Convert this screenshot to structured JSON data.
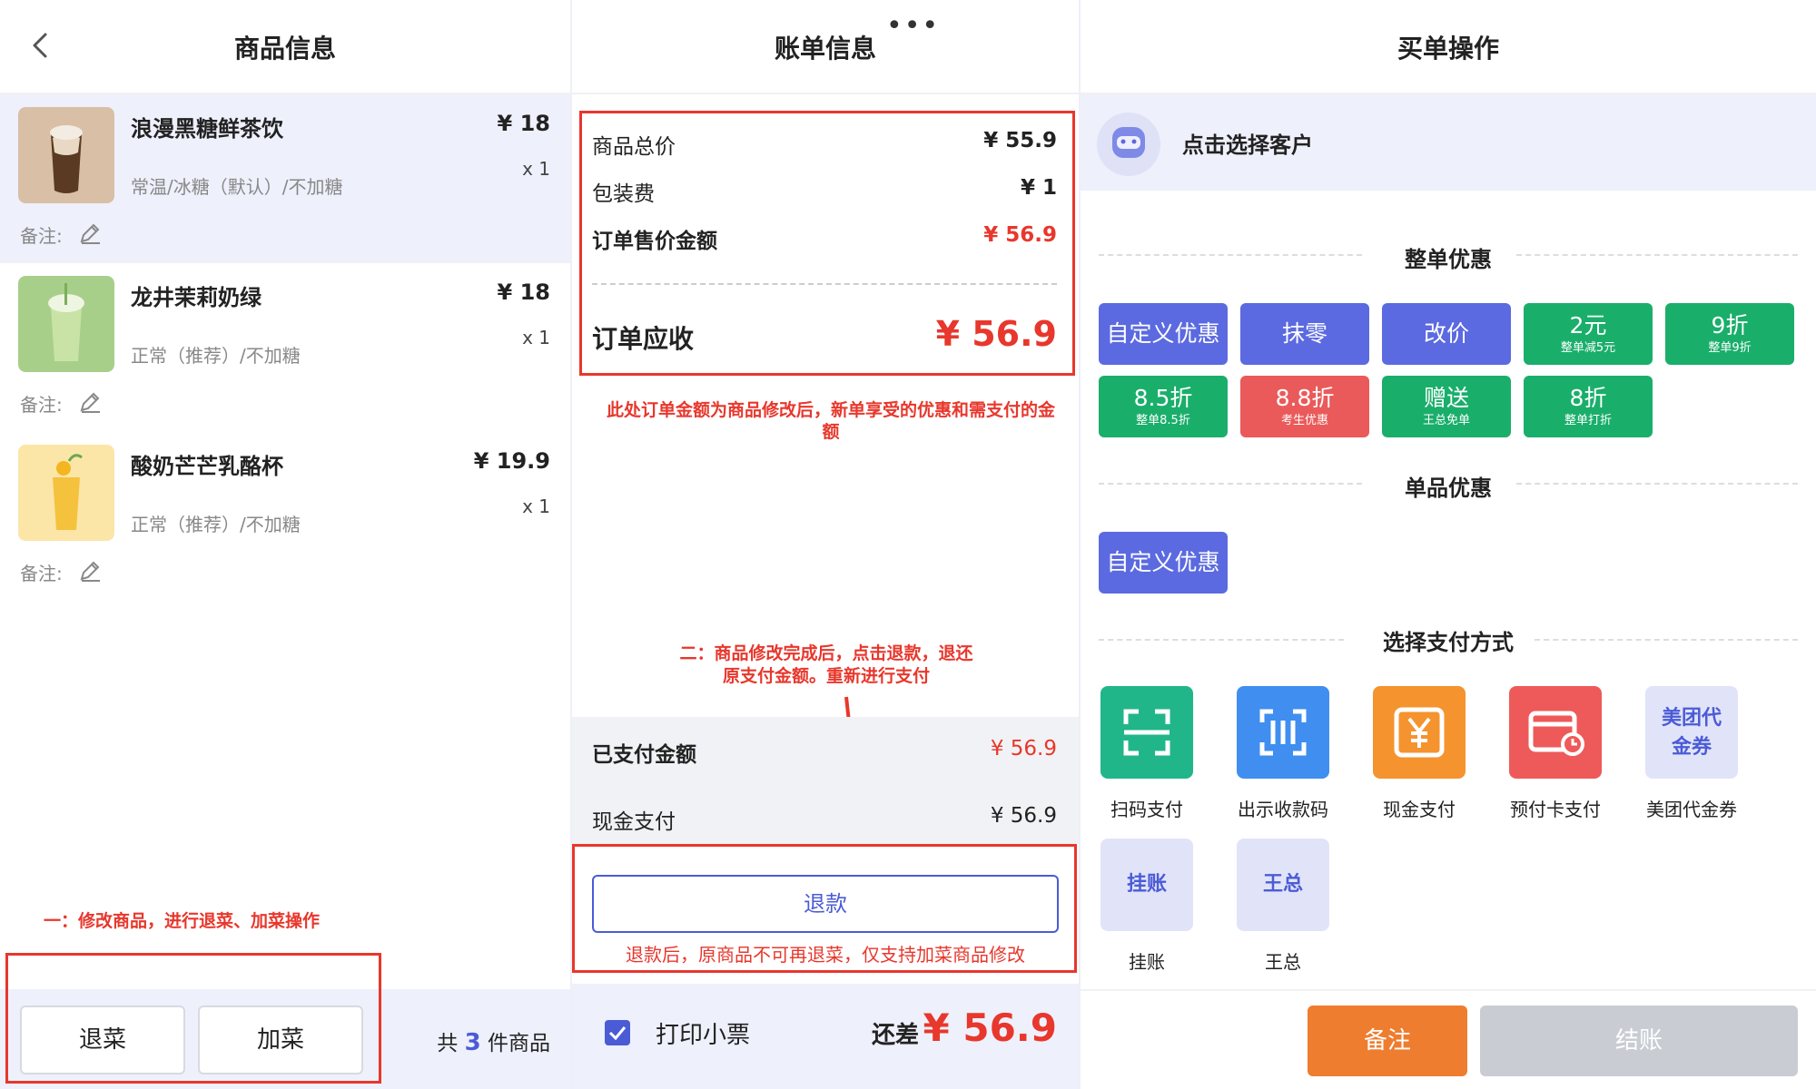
{
  "left": {
    "title": "商品信息",
    "products": [
      {
        "name": "浪漫黑糖鲜茶饮",
        "price": "¥ 18",
        "qty": "x 1",
        "spec": "常温/冰糖（默认）/不加糖",
        "note_label": "备注:"
      },
      {
        "name": "龙井茉莉奶绿",
        "price": "¥ 18",
        "qty": "x 1",
        "spec": "正常（推荐）/不加糖",
        "note_label": "备注:"
      },
      {
        "name": "酸奶芒芒乳酪杯",
        "price": "¥ 19.9",
        "qty": "x 1",
        "spec": "正常（推荐）/不加糖",
        "note_label": "备注:"
      }
    ],
    "annotation": "一：修改商品，进行退菜、加菜操作",
    "return_label": "退菜",
    "add_label": "加菜",
    "count_prefix": "共",
    "count": "3",
    "count_suffix": "件商品"
  },
  "middle": {
    "title": "账单信息",
    "more": "•••",
    "rows": [
      {
        "label": "商品总价",
        "value": "¥ 55.9"
      },
      {
        "label": "包装费",
        "value": "¥ 1"
      },
      {
        "label": "订单售价金额",
        "value": "¥ 56.9"
      }
    ],
    "receivable_label": "订单应收",
    "receivable_value": "¥ 56.9",
    "annotation_1": "此处订单金额为商品修改后，新单享受的优惠和需支付的金额",
    "annotation_2_line1": "二：商品修改完成后，点击退款，退还",
    "annotation_2_line2": "原支付金额。重新进行支付",
    "paid_label": "已支付金额",
    "paid_value": "¥ 56.9",
    "cash_label": "现金支付",
    "cash_value": "¥ 56.9",
    "refund_label": "退款",
    "refund_note": "退款后，原商品不可再退菜，仅支持加菜商品修改",
    "print_label": "打印小票",
    "due_label": "还差",
    "due_value": "¥ 56.9"
  },
  "right": {
    "title": "买单操作",
    "customer_label": "点击选择客户",
    "whole_title": "整单优惠",
    "whole_discounts": [
      {
        "label": "自定义优惠",
        "sub": "",
        "color": "#5b6ae0"
      },
      {
        "label": "抹零",
        "sub": "",
        "color": "#5b6ae0"
      },
      {
        "label": "改价",
        "sub": "",
        "color": "#5b6ae0"
      },
      {
        "label": "2元",
        "sub": "整单减5元",
        "color": "#1aae6b"
      },
      {
        "label": "9折",
        "sub": "整单9折",
        "color": "#1aae6b"
      },
      {
        "label": "8.5折",
        "sub": "整单8.5折",
        "color": "#1aae6b"
      },
      {
        "label": "8.8折",
        "sub": "考生优惠",
        "color": "#ea5a5a"
      },
      {
        "label": "赠送",
        "sub": "王总免单",
        "color": "#1aae6b"
      },
      {
        "label": "8折",
        "sub": "整单打折",
        "color": "#1aae6b"
      }
    ],
    "item_title": "单品优惠",
    "item_discount": "自定义优惠",
    "pay_title": "选择支付方式",
    "pay_methods": [
      {
        "label": "扫码支付",
        "icon": "scan-icon"
      },
      {
        "label": "出示收款码",
        "icon": "barcode-icon"
      },
      {
        "label": "现金支付",
        "icon": "yuan-icon"
      },
      {
        "label": "预付卡支付",
        "icon": "card-icon"
      },
      {
        "label": "美团代金券",
        "icon_text": "美团代金券"
      },
      {
        "label": "挂账",
        "icon_text": "挂账"
      },
      {
        "label": "王总",
        "icon_text": "王总"
      }
    ],
    "note_btn": "备注",
    "checkout_btn": "结账"
  }
}
